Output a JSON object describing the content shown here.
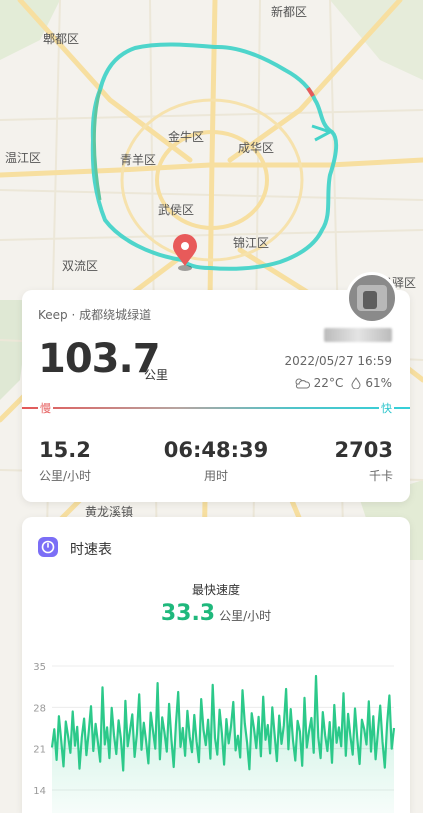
{
  "map": {
    "districts": [
      {
        "name": "新都区",
        "id": "xindu"
      },
      {
        "name": "郫都区",
        "id": "pidu"
      },
      {
        "name": "金牛区",
        "id": "jinniu"
      },
      {
        "name": "成华区",
        "id": "chenghua"
      },
      {
        "name": "青羊区",
        "id": "qingyang"
      },
      {
        "name": "温江区",
        "id": "wenjiang"
      },
      {
        "name": "武侯区",
        "id": "wuhou"
      },
      {
        "name": "锦江区",
        "id": "jinjiang"
      },
      {
        "name": "双流区",
        "id": "shuangliu"
      },
      {
        "name": "龙泉驿区",
        "id": "longquanyi"
      },
      {
        "name": "黄龙溪镇",
        "id": "huanglongxi"
      }
    ],
    "route_color": "#44d3c9",
    "start_pin_color": "#e85a5a"
  },
  "summary": {
    "brand": "Keep · 成都绕城绿道",
    "distance": "103.7",
    "distance_unit": "公里",
    "datetime": "2022/05/27 16:59",
    "temperature": "22°C",
    "humidity": "61%",
    "slow_label": "慢",
    "fast_label": "快",
    "stats": [
      {
        "value": "15.2",
        "label": "公里/小时"
      },
      {
        "value": "06:48:39",
        "label": "用时"
      },
      {
        "value": "2703",
        "label": "千卡"
      }
    ]
  },
  "speed_chart": {
    "title": "时速表",
    "max_label": "最快速度",
    "max_value": "33.3",
    "max_unit": "公里/小时"
  },
  "chart_data": {
    "type": "area",
    "title": "",
    "xlabel": "",
    "ylabel": "",
    "ylim": [
      14,
      35
    ],
    "yticks": [
      14,
      21,
      28,
      35
    ],
    "grid": true,
    "color": "#2cc98a",
    "series": [
      {
        "values": [
          21.2,
          24.3,
          19.1,
          26.5,
          22.4,
          18.0,
          25.6,
          23.1,
          20.3,
          27.3,
          21.5,
          24.7,
          17.6,
          22.9,
          26.1,
          19.9,
          23.8,
          28.2,
          20.6,
          25.2,
          22.1,
          18.8,
          31.4,
          21.7,
          24.6,
          19.4,
          27.9,
          23.3,
          20.1,
          25.8,
          22.7,
          17.3,
          29.1,
          21.4,
          24.1,
          26.8,
          19.6,
          23.5,
          30.2,
          20.8,
          25.4,
          22.3,
          18.5,
          27.1,
          24.0,
          21.0,
          32.1,
          19.2,
          26.3,
          23.7,
          20.5,
          28.6,
          22.6,
          17.9,
          25.1,
          30.6,
          21.3,
          24.5,
          19.8,
          27.4,
          23.0,
          20.4,
          26.7,
          22.2,
          18.7,
          29.4,
          24.2,
          21.6,
          25.9,
          19.3,
          31.8,
          22.8,
          20.0,
          27.6,
          23.6,
          18.3,
          26.0,
          21.9,
          24.8,
          28.9,
          20.7,
          23.2,
          19.5,
          30.9,
          25.3,
          22.0,
          17.5,
          27.0,
          24.4,
          21.1,
          26.4,
          19.7,
          29.8,
          22.5,
          25.0,
          20.2,
          28.0,
          23.4,
          18.9,
          26.6,
          21.8,
          24.9,
          31.1,
          20.9,
          27.7,
          22.4,
          19.0,
          25.7,
          23.9,
          18.1,
          29.6,
          21.2,
          24.0,
          26.2,
          20.3,
          33.3,
          22.9,
          19.4,
          27.2,
          23.3,
          20.6,
          25.5,
          18.6,
          28.4,
          22.0,
          24.6,
          21.4,
          30.4,
          19.8,
          26.9,
          23.1,
          20.0,
          27.8,
          22.7,
          18.4,
          25.9,
          24.3,
          21.7,
          29.0,
          20.5,
          26.5,
          19.2,
          23.8,
          28.3,
          22.2,
          17.8,
          25.2,
          30.0,
          21.0,
          24.5
        ]
      }
    ]
  }
}
